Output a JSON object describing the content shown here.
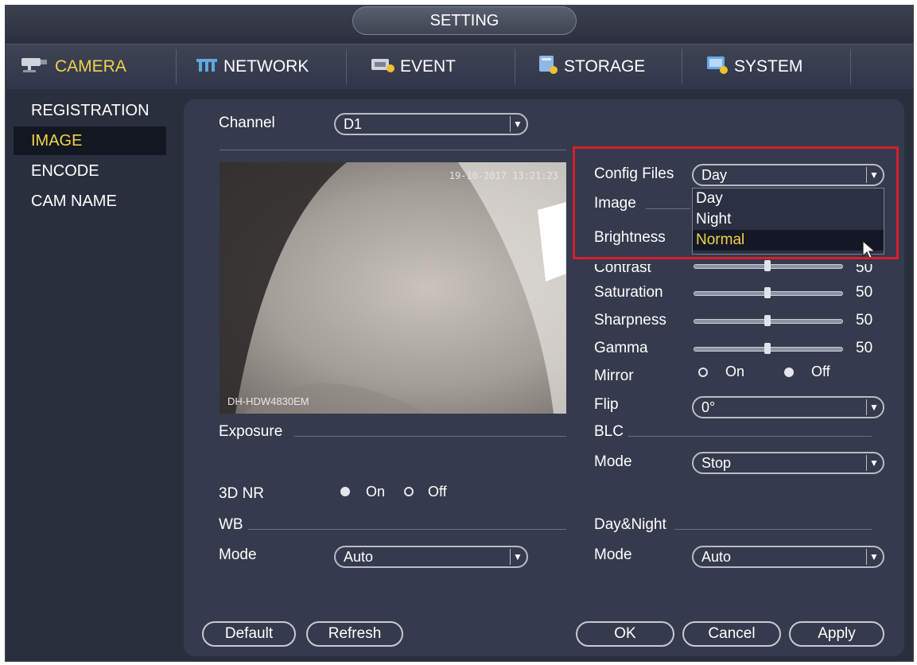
{
  "title": "SETTING",
  "nav": {
    "tabs": [
      {
        "label": "CAMERA",
        "icon": "camera-icon",
        "active": true
      },
      {
        "label": "NETWORK",
        "icon": "network-icon",
        "active": false
      },
      {
        "label": "EVENT",
        "icon": "event-icon",
        "active": false
      },
      {
        "label": "STORAGE",
        "icon": "storage-icon",
        "active": false
      },
      {
        "label": "SYSTEM",
        "icon": "system-icon",
        "active": false
      }
    ]
  },
  "sidebar": {
    "items": [
      {
        "label": "REGISTRATION",
        "active": false
      },
      {
        "label": "IMAGE",
        "active": true
      },
      {
        "label": "ENCODE",
        "active": false
      },
      {
        "label": "CAM NAME",
        "active": false
      }
    ]
  },
  "channel": {
    "label": "Channel",
    "value": "D1"
  },
  "preview": {
    "timestamp": "19-10-2017 13:21:23",
    "model": "DH-HDW4830EM"
  },
  "config_files": {
    "label": "Config Files",
    "value": "Day",
    "options": [
      "Day",
      "Night",
      "Normal"
    ],
    "selected_option": "Normal"
  },
  "image": {
    "section_label": "Image",
    "brightness_label": "Brightness",
    "contrast": {
      "label": "Contrast",
      "value": "50",
      "level": 0.5
    },
    "saturation": {
      "label": "Saturation",
      "value": "50",
      "level": 0.5
    },
    "sharpness": {
      "label": "Sharpness",
      "value": "50",
      "level": 0.5
    },
    "gamma": {
      "label": "Gamma",
      "value": "50",
      "level": 0.5
    },
    "mirror": {
      "label": "Mirror",
      "on": "On",
      "off": "Off",
      "selected": "Off"
    },
    "flip": {
      "label": "Flip",
      "value": "0°"
    }
  },
  "exposure": {
    "label": "Exposure"
  },
  "nr3d": {
    "label": "3D NR",
    "on": "On",
    "off": "Off",
    "selected": "On"
  },
  "wb": {
    "label": "WB",
    "mode_label": "Mode",
    "mode_value": "Auto"
  },
  "blc": {
    "label": "BLC",
    "mode_label": "Mode",
    "mode_value": "Stop"
  },
  "daynight": {
    "label": "Day&Night",
    "mode_label": "Mode",
    "mode_value": "Auto"
  },
  "buttons": {
    "default": "Default",
    "refresh": "Refresh",
    "ok": "OK",
    "cancel": "Cancel",
    "apply": "Apply"
  },
  "colors": {
    "accent": "#f0d24a",
    "highlight": "#d4202a",
    "background": "#2a2f3d"
  }
}
